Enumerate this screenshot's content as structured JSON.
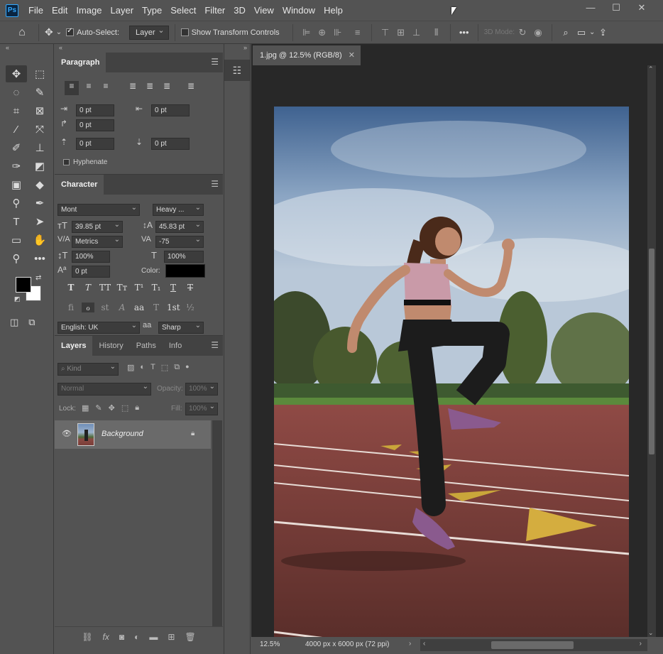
{
  "app": {
    "logo": "Ps"
  },
  "menu": [
    "File",
    "Edit",
    "Image",
    "Layer",
    "Type",
    "Select",
    "Filter",
    "3D",
    "View",
    "Window",
    "Help"
  ],
  "window_controls": {
    "minimize": "—",
    "maximize": "☐",
    "close": "✕"
  },
  "options": {
    "auto_select_label": "Auto-Select:",
    "auto_select_checked": true,
    "auto_select_target": "Layer",
    "show_transform_label": "Show Transform Controls",
    "mode_3d_label": "3D Mode:"
  },
  "paragraph": {
    "tab_label": "Paragraph",
    "indent_left": "0 pt",
    "indent_right": "0 pt",
    "indent_first": "0 pt",
    "space_before": "0 pt",
    "space_after": "0 pt",
    "hyphenate_label": "Hyphenate"
  },
  "character": {
    "tab_label": "Character",
    "font_family": "Mont",
    "font_style": "Heavy ...",
    "font_size": "39.85 pt",
    "leading": "45.83 pt",
    "kerning": "Metrics",
    "tracking": "-75",
    "vertical_scale": "100%",
    "horizontal_scale": "100%",
    "baseline_shift": "0 pt",
    "color_label": "Color:",
    "color_value": "#000000",
    "language": "English: UK",
    "aa_icon": "aa",
    "anti_alias": "Sharp",
    "style_buttons": [
      "T",
      "T",
      "TT",
      "Tт",
      "T¹",
      "T₁",
      "T",
      "T"
    ],
    "opentype_buttons": [
      "fi",
      "ℴ",
      "st",
      "A",
      "aa",
      "T",
      "1st",
      "½"
    ]
  },
  "layers": {
    "tabs": [
      "Layers",
      "History",
      "Paths",
      "Info"
    ],
    "kind_placeholder": "Kind",
    "blend_mode": "Normal",
    "opacity_label": "Opacity:",
    "opacity_value": "100%",
    "lock_label": "Lock:",
    "fill_label": "Fill:",
    "fill_value": "100%",
    "items": [
      {
        "name": "Background",
        "visible": true,
        "locked": true
      }
    ],
    "footer_icons": [
      "link-icon",
      "fx-icon",
      "mask-icon",
      "adjustment-icon",
      "folder-icon",
      "new-layer-icon",
      "trash-icon"
    ]
  },
  "document": {
    "tab_title": "1.jpg @ 12.5% (RGB/8)",
    "zoom": "12.5%",
    "doc_info": "4000 px x 6000 px (72 ppi)"
  },
  "colors": {
    "ui_bg": "#535353",
    "panel_tab_bg": "#424242",
    "canvas_bg": "#282828",
    "field_bg": "#3c3c3c",
    "foreground": "#000000",
    "background": "#ffffff",
    "accent": "#31a8ff"
  }
}
